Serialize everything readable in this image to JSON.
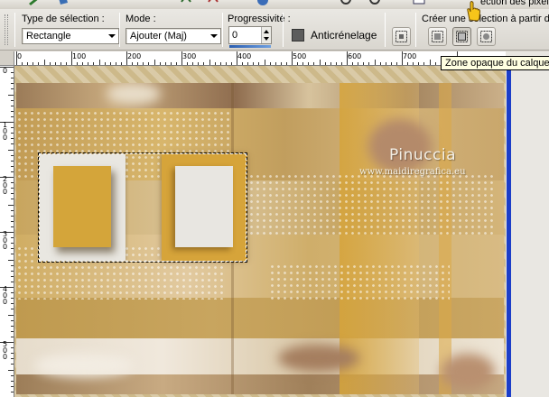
{
  "toolbar_top": {
    "partial_heading": "ection des pixel"
  },
  "toolbar": {
    "selection_type": {
      "label": "Type de sélection :",
      "value": "Rectangle"
    },
    "mode": {
      "label": "Mode :",
      "value": "Ajouter (Maj)"
    },
    "feather": {
      "label": "Progressivité :",
      "value": "0"
    },
    "antialias": {
      "label": "Anticrénelage",
      "checked": true
    },
    "create_from": {
      "label": "Créer une sélection à partir de :",
      "buttons": [
        {
          "icon": "selection-from-canvas-icon"
        },
        {
          "icon": "selection-from-opaque-layer-icon",
          "pressed": true
        },
        {
          "icon": "selection-from-layer-icon"
        }
      ]
    }
  },
  "tooltip": {
    "text": "Zone opaque du calque"
  },
  "ruler": {
    "h_labels": [
      "0",
      "100",
      "200",
      "300",
      "400",
      "500",
      "600",
      "700"
    ],
    "v_labels": [
      "0",
      "1\n0\n0",
      "2\n0\n0",
      "3\n0\n0",
      "4\n0\n0",
      "5\n0\n0"
    ]
  },
  "canvas": {
    "watermark_title": "Pinuccia",
    "watermark_url": "www.maidiregrafica.eu"
  },
  "colors": {
    "gold": "#d4a53a",
    "cream": "#e9e7e1",
    "selection_blue": "#1c3ec8"
  }
}
